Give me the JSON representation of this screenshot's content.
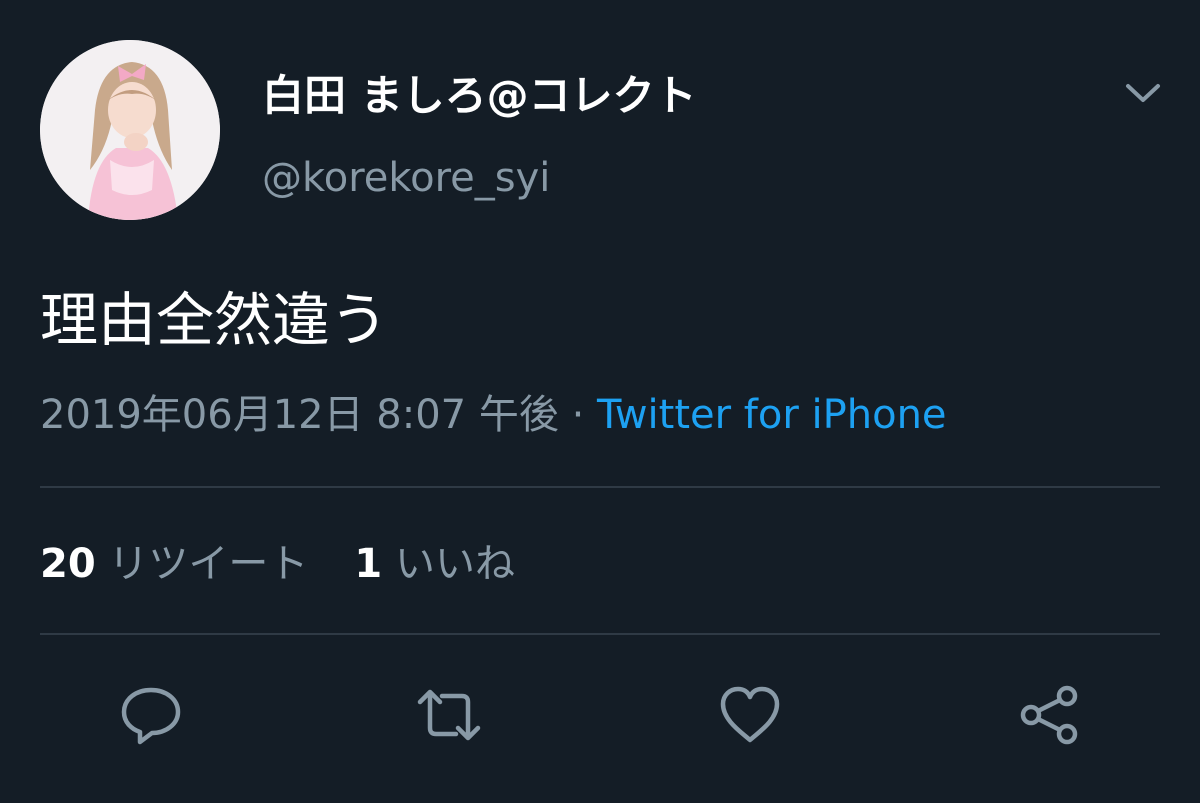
{
  "tweet": {
    "display_name": "白田 ましろ@コレクト",
    "handle": "@korekore_syi",
    "text": "理由全然違う",
    "timestamp": "2019年06月12日 8:07 午後",
    "separator": " · ",
    "source": "Twitter for iPhone"
  },
  "stats": {
    "retweets_count": "20",
    "retweets_label": "リツイート",
    "likes_count": "1",
    "likes_label": "いいね"
  },
  "actions": {
    "reply_icon": "reply-icon",
    "retweet_icon": "retweet-icon",
    "like_icon": "heart-icon",
    "share_icon": "share-icon"
  },
  "colors": {
    "background": "#141d26",
    "primary_text": "#ffffff",
    "secondary_text": "#8899a6",
    "link": "#1da1f2",
    "divider": "#2f3a45"
  }
}
